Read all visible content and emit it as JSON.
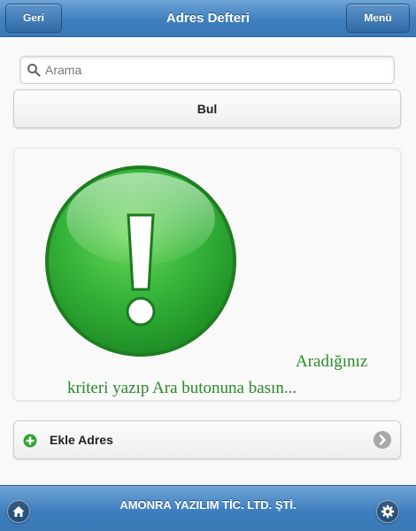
{
  "header": {
    "title": "Adres Defteri",
    "back_label": "Geri",
    "menu_label": "Menü"
  },
  "search": {
    "placeholder": "Arama",
    "value": "",
    "icon": "search-icon"
  },
  "find_button": {
    "label": "Bul"
  },
  "message": {
    "line1": "Aradığınız",
    "line2": "kriteri yazıp Ara butonuna basın...",
    "icon": "exclamation-icon",
    "color": "#2b8a2b"
  },
  "add_address": {
    "label": "Ekle Adres",
    "icon": "plus-circle-icon",
    "arrow_icon": "chevron-right-icon"
  },
  "footer": {
    "company": "AMONRA YAZILIM TİC. LTD. ŞTİ.",
    "left_icon": "home-icon",
    "right_icon": "gear-icon"
  },
  "colors": {
    "bar": "#3f7fbf",
    "success": "#2fa52f"
  }
}
